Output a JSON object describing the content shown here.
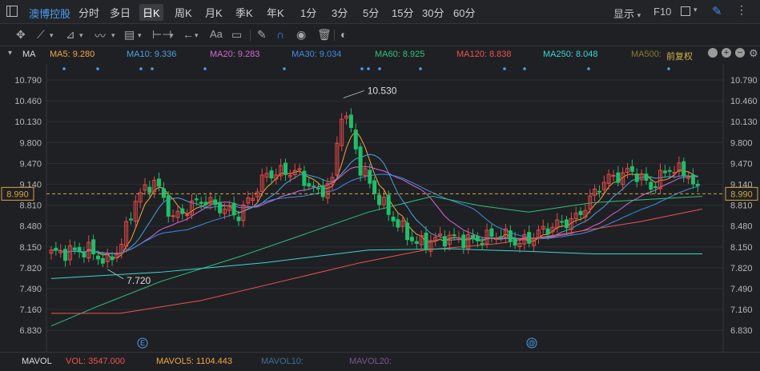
{
  "topbar": {
    "stock_name": "澳博控股",
    "tabs": [
      "分时",
      "多日",
      "日K",
      "周K",
      "月K",
      "季K",
      "年K",
      "1分",
      "3分",
      "5分",
      "15分",
      "30分",
      "60分"
    ],
    "active_tab": "日K",
    "display_label": "显示",
    "f10_label": "F10"
  },
  "toolbar": {
    "text_tool_label": "Aa"
  },
  "ma_bar": {
    "label": "MA",
    "items": [
      {
        "text": "MA5: 9.280",
        "color": "#f4a741"
      },
      {
        "text": "MA10: 9.336",
        "color": "#4aa3e0"
      },
      {
        "text": "MA20: 9.283",
        "color": "#d26ad6"
      },
      {
        "text": "MA30: 9.034",
        "color": "#3f8de8"
      },
      {
        "text": "MA60: 8.925",
        "color": "#2ec27e"
      },
      {
        "text": "MA120: 8.838",
        "color": "#ef5350"
      },
      {
        "text": "MA250: 8.048",
        "color": "#3ad6d6"
      },
      {
        "text": "MA500:",
        "color": "#8a7a3a"
      }
    ],
    "adjust_label": "前复权"
  },
  "axis": {
    "ticks": [
      "10.790",
      "10.460",
      "10.130",
      "9.800",
      "9.470",
      "9.140",
      "8.810",
      "8.480",
      "8.150",
      "7.820",
      "7.490",
      "7.160",
      "6.830"
    ],
    "current_price": "8.990"
  },
  "annotations": {
    "high": "10.530",
    "low": "7.720"
  },
  "markers": {
    "e": "E",
    "at": "@"
  },
  "volume_bar": {
    "label": "MAVOL",
    "vol": "VOL: 3547.000",
    "mavol5": "MAVOL5: 1104.443",
    "mavol10": "MAVOL10:",
    "mavol20": "MAVOL20:"
  },
  "colors": {
    "up": "#e34a4a",
    "down": "#1fbf6a",
    "grid": "#2c2e33",
    "current": "#d9a441"
  }
}
